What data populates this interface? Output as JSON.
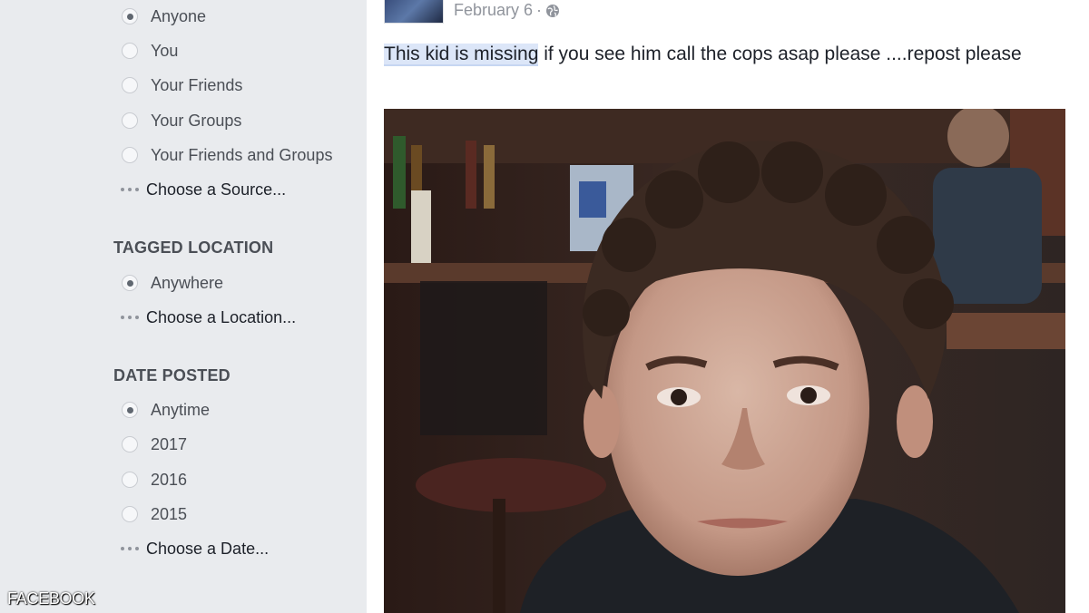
{
  "filters": {
    "posted_by": {
      "options": [
        {
          "label": "Anyone",
          "checked": true
        },
        {
          "label": "You",
          "checked": false
        },
        {
          "label": "Your Friends",
          "checked": false
        },
        {
          "label": "Your Groups",
          "checked": false
        },
        {
          "label": "Your Friends and Groups",
          "checked": false
        }
      ],
      "more_label": "Choose a Source..."
    },
    "tagged_location": {
      "heading": "TAGGED LOCATION",
      "options": [
        {
          "label": "Anywhere",
          "checked": true
        }
      ],
      "more_label": "Choose a Location..."
    },
    "date_posted": {
      "heading": "DATE POSTED",
      "options": [
        {
          "label": "Anytime",
          "checked": true
        },
        {
          "label": "2017",
          "checked": false
        },
        {
          "label": "2016",
          "checked": false
        },
        {
          "label": "2015",
          "checked": false
        }
      ],
      "more_label": "Choose a Date..."
    }
  },
  "post": {
    "date": "February 6",
    "separator": "·",
    "privacy_icon": "globe-icon",
    "text_highlight": "This kid is missing",
    "text_rest": " if you see him call the cops asap please ....repost please",
    "photo_icon": "post-photo"
  },
  "watermark": "FACEBOOK",
  "colors": {
    "sidebar_bg": "#e9ebee",
    "post_bg": "#ffffff",
    "highlight": "#dce6f8",
    "text_dark": "#1d2129",
    "text_muted": "#90949c"
  }
}
